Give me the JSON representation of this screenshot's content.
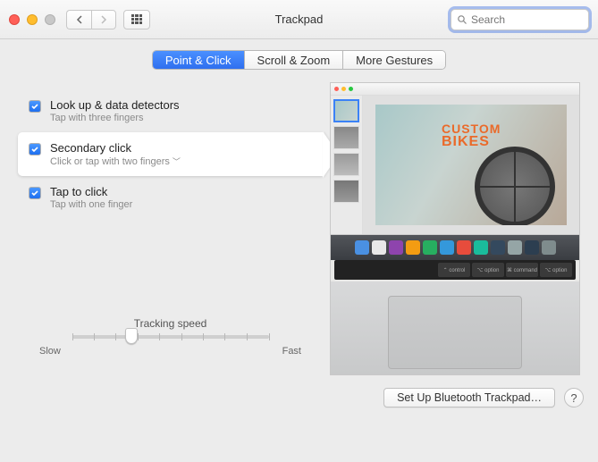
{
  "window": {
    "title": "Trackpad",
    "search_placeholder": "Search"
  },
  "tabs": [
    {
      "label": "Point & Click",
      "active": true
    },
    {
      "label": "Scroll & Zoom",
      "active": false
    },
    {
      "label": "More Gestures",
      "active": false
    }
  ],
  "options": {
    "lookup": {
      "checked": true,
      "title": "Look up & data detectors",
      "sub": "Tap with three fingers"
    },
    "secondary": {
      "checked": true,
      "title": "Secondary click",
      "sub": "Click or tap with two fingers",
      "has_menu": true,
      "selected": true
    },
    "tap": {
      "checked": true,
      "title": "Tap to click",
      "sub": "Tap with one finger"
    }
  },
  "tracking": {
    "label": "Tracking speed",
    "min_label": "Slow",
    "max_label": "Fast",
    "ticks": 10,
    "position_pct": 30
  },
  "preview": {
    "headline_l1": "CUSTOM",
    "headline_l2": "BIKES",
    "touchbar_keys": [
      "⌃ control",
      "⌥ option",
      "⌘ command",
      "⌥ option"
    ]
  },
  "footer": {
    "bluetooth_button": "Set Up Bluetooth Trackpad…",
    "help": "?"
  },
  "colors": {
    "accent": "#2f6fef",
    "orange": "#ea6a2a"
  }
}
